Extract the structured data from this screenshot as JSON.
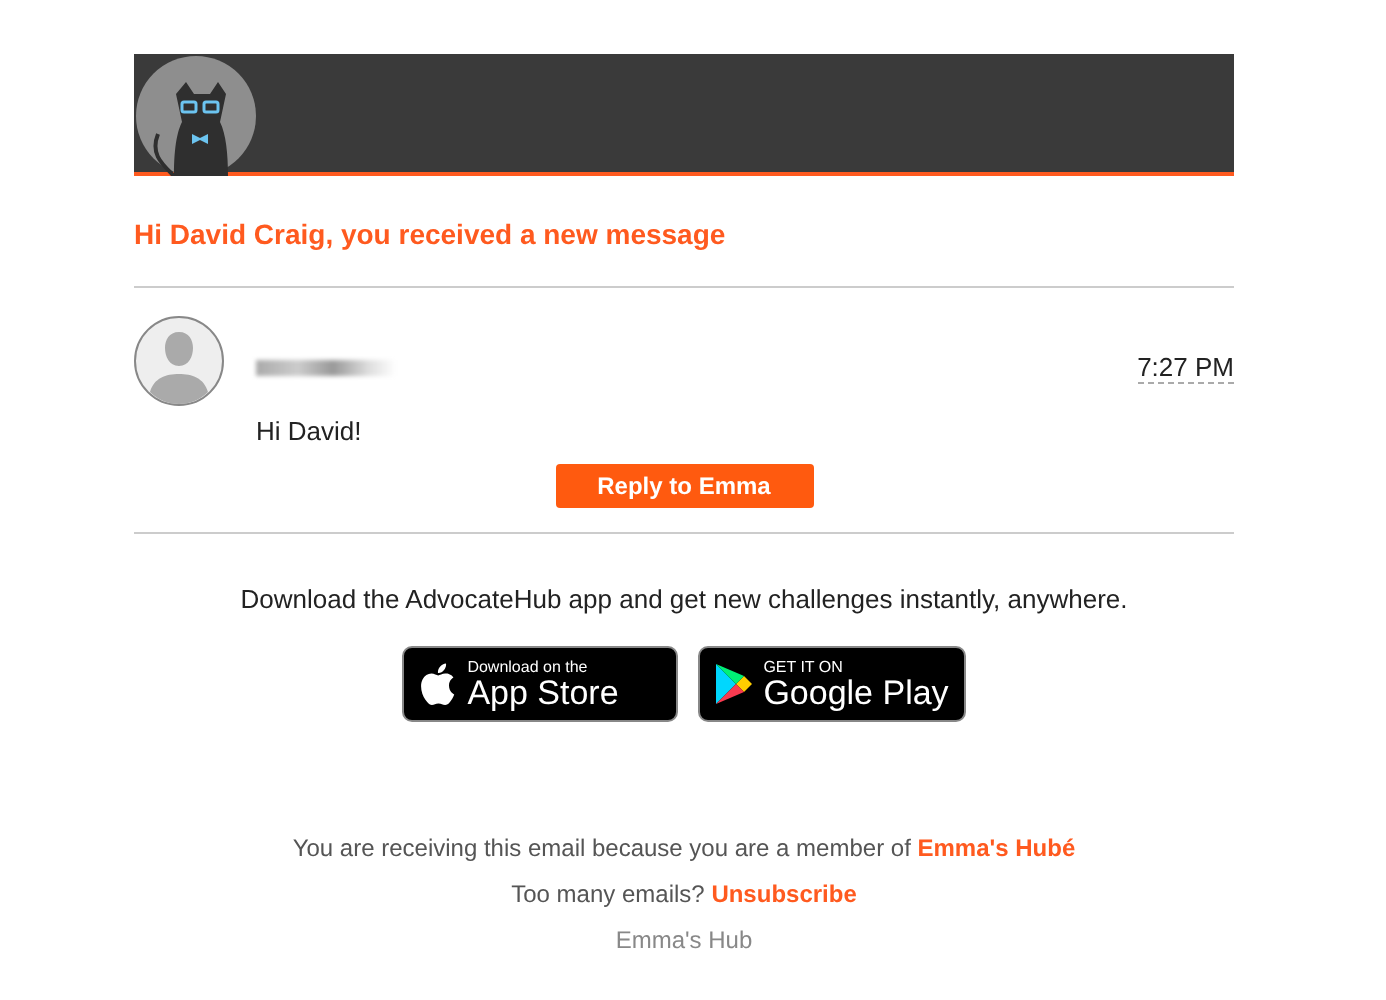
{
  "greeting": "Hi David Craig, you received a new message",
  "message": {
    "time": "7:27 PM",
    "body": "Hi David!",
    "reply_button": "Reply to Emma"
  },
  "download": {
    "text": "Download the AdvocateHub app and get new challenges instantly, anywhere.",
    "badges": [
      {
        "kind": "apple",
        "small": "Download on the",
        "big": "App Store"
      },
      {
        "kind": "google",
        "small": "GET IT ON",
        "big": "Google Play"
      }
    ]
  },
  "footer": {
    "membership": {
      "text": "You are receiving this email because you are a member of",
      "link": "Emma's Hubé"
    },
    "unsubscribe": {
      "text": "Too many emails?",
      "link": "Unsubscribe"
    },
    "hub_name": "Emma's Hub"
  }
}
